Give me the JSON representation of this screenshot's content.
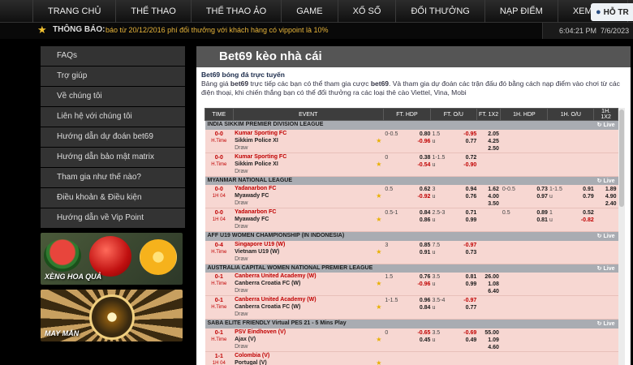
{
  "nav": {
    "items": [
      "TRANG CHỦ",
      "THỂ THAO",
      "THỂ THAO ẢO",
      "GAME",
      "XỔ SỐ",
      "ĐỔI THƯỞNG",
      "NẠP ĐIỂM",
      "XEM THÊ"
    ],
    "support": "HỖ TR"
  },
  "notice": {
    "label": "THÔNG BÁO:",
    "text": "báo từ 20/12/2016 phí đổi thưởng với khách hàng có vippoint là 10%"
  },
  "clock": {
    "time": "6:04:21 PM",
    "date": "7/6/2023"
  },
  "sidebar": {
    "items": [
      "FAQs",
      "Trợ giúp",
      "Về chúng tôi",
      "Liên hệ với chúng tôi",
      "Hướng dẫn dự đoán bet69",
      "Hướng dẫn bảo mật matrix",
      "Tham gia như thế nào?",
      "Điều khoản & Điều kiện",
      "Hướng dẫn về Vip Point"
    ]
  },
  "banners": [
    {
      "label": "XÈNG HOA QUẢ"
    },
    {
      "label": "MAY MẮN"
    }
  ],
  "content": {
    "title": "Bet69 kèo nhà cái",
    "subtitle": "Bet69 bóng đá trực tuyến",
    "intro_a": "Bảng giá ",
    "intro_b": "bet69",
    "intro_c": " trực tiếp các bạn có thể tham gia cược ",
    "intro_d": "bet69",
    "intro_e": ". Và tham gia dự đoán các trận đấu đó bằng cách nạp điểm vào chơi từ các điện thoại, khi chiến thắng bạn có thể đổi thưởng ra các loại thẻ cào Viettel, Vina, Mobi"
  },
  "odds": {
    "headers": [
      "TIME",
      "EVENT",
      "FT. HDP",
      "FT. O/U",
      "FT. 1X2",
      "1H. HDP",
      "1H. O/U",
      "1H. 1X2"
    ],
    "live_label": "Live",
    "draw_label": "Draw",
    "leagues": [
      {
        "name": "INDIA SIKKIM PREMIER DIVISION LEAGUE",
        "matches": [
          {
            "score": "0-0",
            "status": "H.Time",
            "home": "Kumar Sporting FC",
            "away": "Sikkim Police XI",
            "ft_hdp_line": "0-0.5",
            "ft_hdp_home": "0.80",
            "ft_hdp_away": "-0.96",
            "ft_ou_line": "1.5",
            "ft_ou_u": "u",
            "ft_ou_over": "-0.95",
            "ft_ou_under": "0.77",
            "ft_1": "2.05",
            "ft_2": "4.25",
            "ft_x": "2.50",
            "h1_hdp_line": "",
            "h1_hdp_home": "",
            "h1_hdp_away": "",
            "h1_ou_line": "",
            "h1_ou_u": "",
            "h1_ou_over": "",
            "h1_ou_under": "",
            "h1_1": "",
            "h1_2": "",
            "h1_x": ""
          },
          {
            "score": "0-0",
            "status": "H.Time",
            "home": "Kumar Sporting FC",
            "away": "Sikkim Police XI",
            "ft_hdp_line": "0",
            "ft_hdp_home": "0.38",
            "ft_hdp_away": "-0.54",
            "ft_ou_line": "1-1.5",
            "ft_ou_u": "u",
            "ft_ou_over": "0.72",
            "ft_ou_under": "-0.90",
            "ft_1": "",
            "ft_2": "",
            "ft_x": "",
            "h1_hdp_line": "",
            "h1_hdp_home": "",
            "h1_hdp_away": "",
            "h1_ou_line": "",
            "h1_ou_u": "",
            "h1_ou_over": "",
            "h1_ou_under": "",
            "h1_1": "",
            "h1_2": "",
            "h1_x": ""
          }
        ]
      },
      {
        "name": "MYANMAR NATIONAL LEAGUE",
        "matches": [
          {
            "score": "0-0",
            "status": "1H 04",
            "home": "Yadanarbon FC",
            "away": "Myawady FC",
            "ft_hdp_line": "0.5",
            "ft_hdp_home": "0.62",
            "ft_hdp_away": "-0.92",
            "ft_ou_line": "3",
            "ft_ou_u": "u",
            "ft_ou_over": "0.94",
            "ft_ou_under": "0.76",
            "ft_1": "1.62",
            "ft_2": "4.00",
            "ft_x": "3.50",
            "h1_hdp_line": "0-0.5",
            "h1_hdp_home": "0.73",
            "h1_hdp_away": "0.97",
            "h1_ou_line": "1-1.5",
            "h1_ou_u": "u",
            "h1_ou_over": "0.91",
            "h1_ou_under": "0.79",
            "h1_1": "1.89",
            "h1_2": "4.90",
            "h1_x": "2.40"
          },
          {
            "score": "0-0",
            "status": "1H 04",
            "home": "Yadanarbon FC",
            "away": "Myawady FC",
            "ft_hdp_line": "0.5-1",
            "ft_hdp_home": "0.84",
            "ft_hdp_away": "0.86",
            "ft_ou_line": "2.5-3",
            "ft_ou_u": "u",
            "ft_ou_over": "0.71",
            "ft_ou_under": "0.99",
            "ft_1": "",
            "ft_2": "",
            "ft_x": "",
            "h1_hdp_line": "0.5",
            "h1_hdp_home": "0.89",
            "h1_hdp_away": "0.81",
            "h1_ou_line": "1",
            "h1_ou_u": "u",
            "h1_ou_over": "0.52",
            "h1_ou_under": "-0.82",
            "h1_1": "",
            "h1_2": "",
            "h1_x": ""
          }
        ]
      },
      {
        "name": "AFF U19 WOMEN CHAMPIONSHIP (IN INDONESIA)",
        "matches": [
          {
            "score": "0-4",
            "status": "H.Time",
            "home": "Singapore U19 (W)",
            "away": "Vietnam U19 (W)",
            "ft_hdp_line": "3",
            "ft_hdp_home": "0.85",
            "ft_hdp_away": "0.91",
            "ft_ou_line": "7.5",
            "ft_ou_u": "u",
            "ft_ou_over": "-0.97",
            "ft_ou_under": "0.73",
            "ft_1": "",
            "ft_2": "",
            "ft_x": "",
            "h1_hdp_line": "",
            "h1_hdp_home": "",
            "h1_hdp_away": "",
            "h1_ou_line": "",
            "h1_ou_u": "",
            "h1_ou_over": "",
            "h1_ou_under": "",
            "h1_1": "",
            "h1_2": "",
            "h1_x": ""
          }
        ]
      },
      {
        "name": "AUSTRALIA CAPITAL WOMEN NATIONAL PREMIER LEAGUE",
        "matches": [
          {
            "score": "0-1",
            "status": "H.Time",
            "home": "Canberra United Academy (W)",
            "away": "Canberra Croatia FC (W)",
            "ft_hdp_line": "1.5",
            "ft_hdp_home": "0.76",
            "ft_hdp_away": "-0.96",
            "ft_ou_line": "3.5",
            "ft_ou_u": "u",
            "ft_ou_over": "0.81",
            "ft_ou_under": "0.99",
            "ft_1": "26.00",
            "ft_2": "1.08",
            "ft_x": "6.40",
            "h1_hdp_line": "",
            "h1_hdp_home": "",
            "h1_hdp_away": "",
            "h1_ou_line": "",
            "h1_ou_u": "",
            "h1_ou_over": "",
            "h1_ou_under": "",
            "h1_1": "",
            "h1_2": "",
            "h1_x": ""
          },
          {
            "score": "0-1",
            "status": "H.Time",
            "home": "Canberra United Academy (W)",
            "away": "Canberra Croatia FC (W)",
            "ft_hdp_line": "1-1.5",
            "ft_hdp_home": "0.96",
            "ft_hdp_away": "0.84",
            "ft_ou_line": "3.5-4",
            "ft_ou_u": "u",
            "ft_ou_over": "-0.97",
            "ft_ou_under": "0.77",
            "ft_1": "",
            "ft_2": "",
            "ft_x": "",
            "h1_hdp_line": "",
            "h1_hdp_home": "",
            "h1_hdp_away": "",
            "h1_ou_line": "",
            "h1_ou_u": "",
            "h1_ou_over": "",
            "h1_ou_under": "",
            "h1_1": "",
            "h1_2": "",
            "h1_x": ""
          }
        ]
      },
      {
        "name": "SABA ELITE FRIENDLY Virtual PES 21 - 5 Mins Play",
        "matches": [
          {
            "score": "0-1",
            "status": "H.Time",
            "home": "PSV Eindhoven (V)",
            "away": "Ajax (V)",
            "ft_hdp_line": "0",
            "ft_hdp_home": "-0.65",
            "ft_hdp_away": "0.45",
            "ft_ou_line": "3.5",
            "ft_ou_u": "u",
            "ft_ou_over": "-0.69",
            "ft_ou_under": "0.49",
            "ft_1": "55.00",
            "ft_2": "1.09",
            "ft_x": "4.60",
            "h1_hdp_line": "",
            "h1_hdp_home": "",
            "h1_hdp_away": "",
            "h1_ou_line": "",
            "h1_ou_u": "",
            "h1_ou_over": "",
            "h1_ou_under": "",
            "h1_1": "",
            "h1_2": "",
            "h1_x": ""
          },
          {
            "score": "1-1",
            "status": "1H 04",
            "home": "Colombia (V)",
            "away": "Portugal (V)",
            "ft_hdp_line": "",
            "ft_hdp_home": "",
            "ft_hdp_away": "",
            "ft_ou_line": "",
            "ft_ou_u": "",
            "ft_ou_over": "",
            "ft_ou_under": "",
            "ft_1": "",
            "ft_2": "",
            "ft_x": "",
            "h1_hdp_line": "",
            "h1_hdp_home": "",
            "h1_hdp_away": "",
            "h1_ou_line": "",
            "h1_ou_u": "",
            "h1_ou_over": "",
            "h1_ou_under": "",
            "h1_1": "",
            "h1_2": "",
            "h1_x": ""
          }
        ]
      }
    ]
  },
  "colors": {
    "accent_red": "#c00000",
    "row_pink": "#f7d7d2",
    "league_gray": "#a9acb2",
    "notice_gold": "#e8b53a"
  }
}
